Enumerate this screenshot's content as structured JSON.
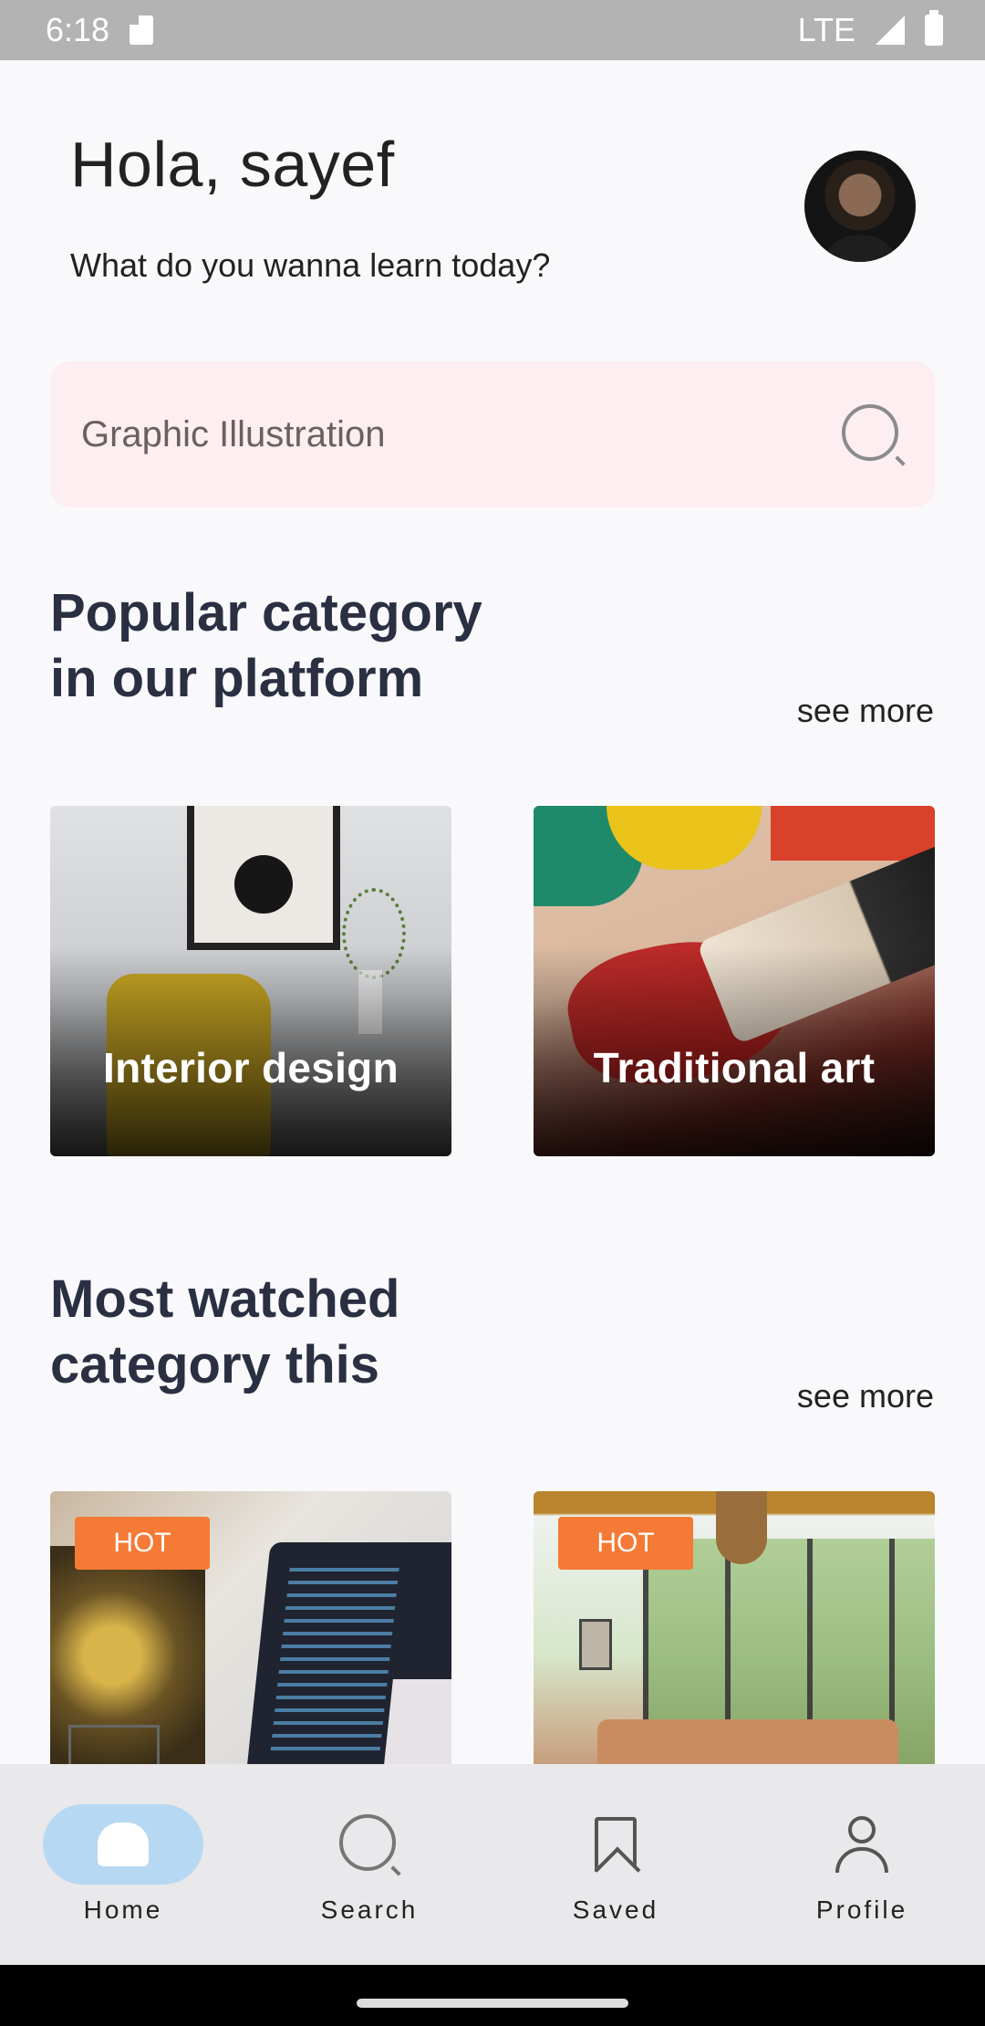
{
  "status_bar": {
    "time": "6:18",
    "network": "LTE",
    "sd_icon": "sd-card-icon",
    "signal_icon": "signal-icon",
    "battery_icon": "battery-icon"
  },
  "header": {
    "greeting": "Hola, sayef",
    "subtitle": "What do you wanna learn today?",
    "avatar_icon": "avatar"
  },
  "search": {
    "placeholder": "Graphic Illustration",
    "icon": "search-icon",
    "background": "#fdeef1"
  },
  "popular": {
    "title_line1": "Popular category",
    "title_line2": "in our platform",
    "see_more": "see more",
    "cards": [
      {
        "label": "Interior design"
      },
      {
        "label": "Traditional art"
      }
    ]
  },
  "most_watched": {
    "title_line1": "Most watched",
    "title_line2": "category this",
    "see_more": "see more",
    "cards": [
      {
        "badge": "HOT"
      },
      {
        "badge": "HOT"
      }
    ]
  },
  "bottom_nav": {
    "items": [
      {
        "label": "Home",
        "icon": "home-icon",
        "active": true
      },
      {
        "label": "Search",
        "icon": "search-icon",
        "active": false
      },
      {
        "label": "Saved",
        "icon": "bookmark-icon",
        "active": false
      },
      {
        "label": "Profile",
        "icon": "profile-icon",
        "active": false
      }
    ],
    "active_color": "#b6d8f3"
  },
  "colors": {
    "accent_badge": "#f47a36",
    "title_text": "#2a3042"
  }
}
